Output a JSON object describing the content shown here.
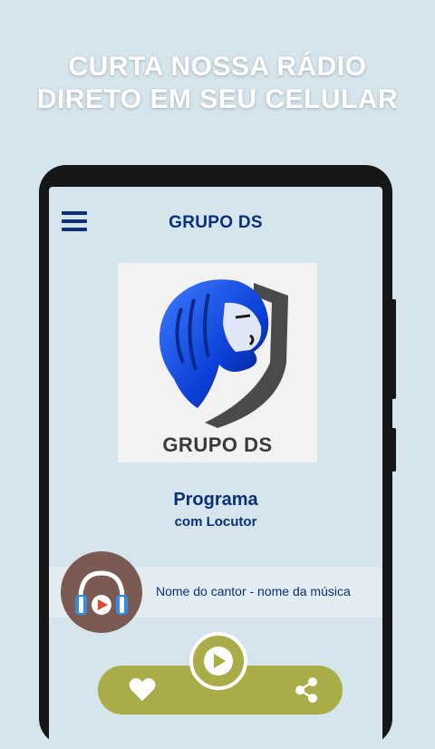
{
  "promo": {
    "line1": "CURTA NOSSA RÁDIO",
    "line2": "DIRETO EM SEU CELULAR"
  },
  "app": {
    "title": "GRUPO DS",
    "logo_text": "GRUPO DS"
  },
  "program": {
    "title": "Programa",
    "subtitle": "com Locutor"
  },
  "now_playing": {
    "track": "Nome do cantor - nome da música"
  },
  "icons": {
    "menu": "hamburger-menu-icon",
    "avatar": "headphones-icon",
    "play": "play-icon",
    "like": "heart-icon",
    "share": "share-icon"
  },
  "colors": {
    "background": "#d6e4ec",
    "primary_text": "#0b2f7a",
    "controls": "#a8ad47",
    "avatar_bg": "#7a5a52",
    "logo_blue": "#1a5cff"
  }
}
